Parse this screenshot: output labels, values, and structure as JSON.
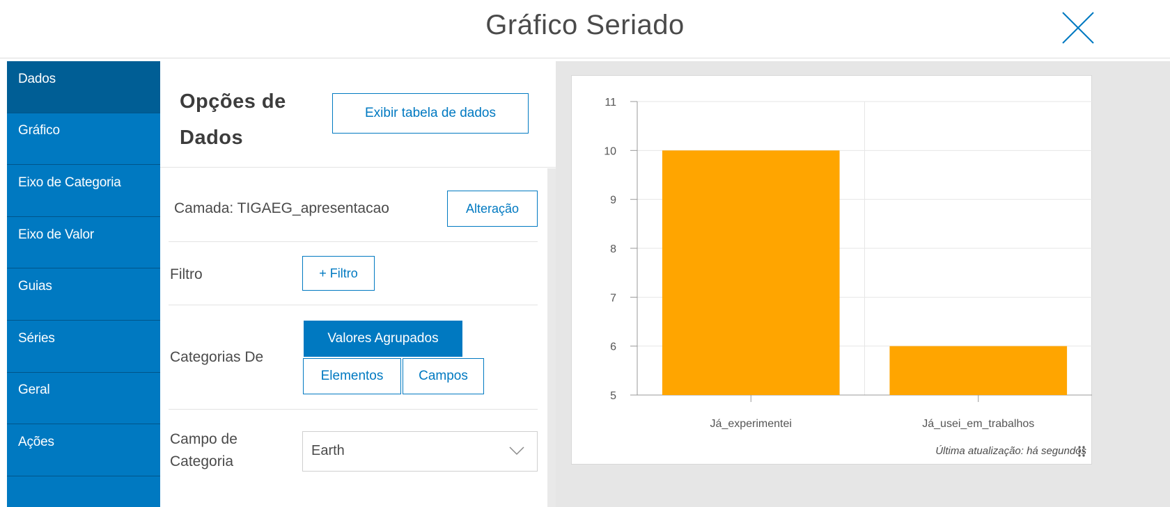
{
  "header": {
    "title": "Gráfico Seriado"
  },
  "sidebar": {
    "items": [
      {
        "label": "Dados"
      },
      {
        "label": "Gráfico"
      },
      {
        "label": "Eixo de Categoria"
      },
      {
        "label": "Eixo de Valor"
      },
      {
        "label": "Guias"
      },
      {
        "label": "Séries"
      },
      {
        "label": "Geral"
      },
      {
        "label": "Ações"
      }
    ]
  },
  "options": {
    "title": "Opções de Dados",
    "show_table_label": "Exibir tabela de dados",
    "layer_label": "Camada: TIGAEG_apresentacao",
    "change_label": "Alteração",
    "filter_label": "Filtro",
    "add_filter_label": "+ Filtro",
    "categories_from_label": "Categorias De",
    "cat_options": [
      "Valores Agrupados",
      "Elementos",
      "Campos"
    ],
    "category_field_label": "Campo de Categoria",
    "category_field_value": "Earth"
  },
  "chart_footer": {
    "updated": "Última atualização: há segundos"
  },
  "colors": {
    "accent": "#0079c1",
    "accent_dark": "#005e95",
    "bar": "#ffa500"
  },
  "chart_data": {
    "type": "bar",
    "categories": [
      "Já_experimentei",
      "Já_usei_em_trabalhos"
    ],
    "values": [
      10,
      6
    ],
    "ylim": [
      5,
      11
    ],
    "yticks": [
      5,
      6,
      7,
      8,
      9,
      10,
      11
    ],
    "grid": true
  }
}
